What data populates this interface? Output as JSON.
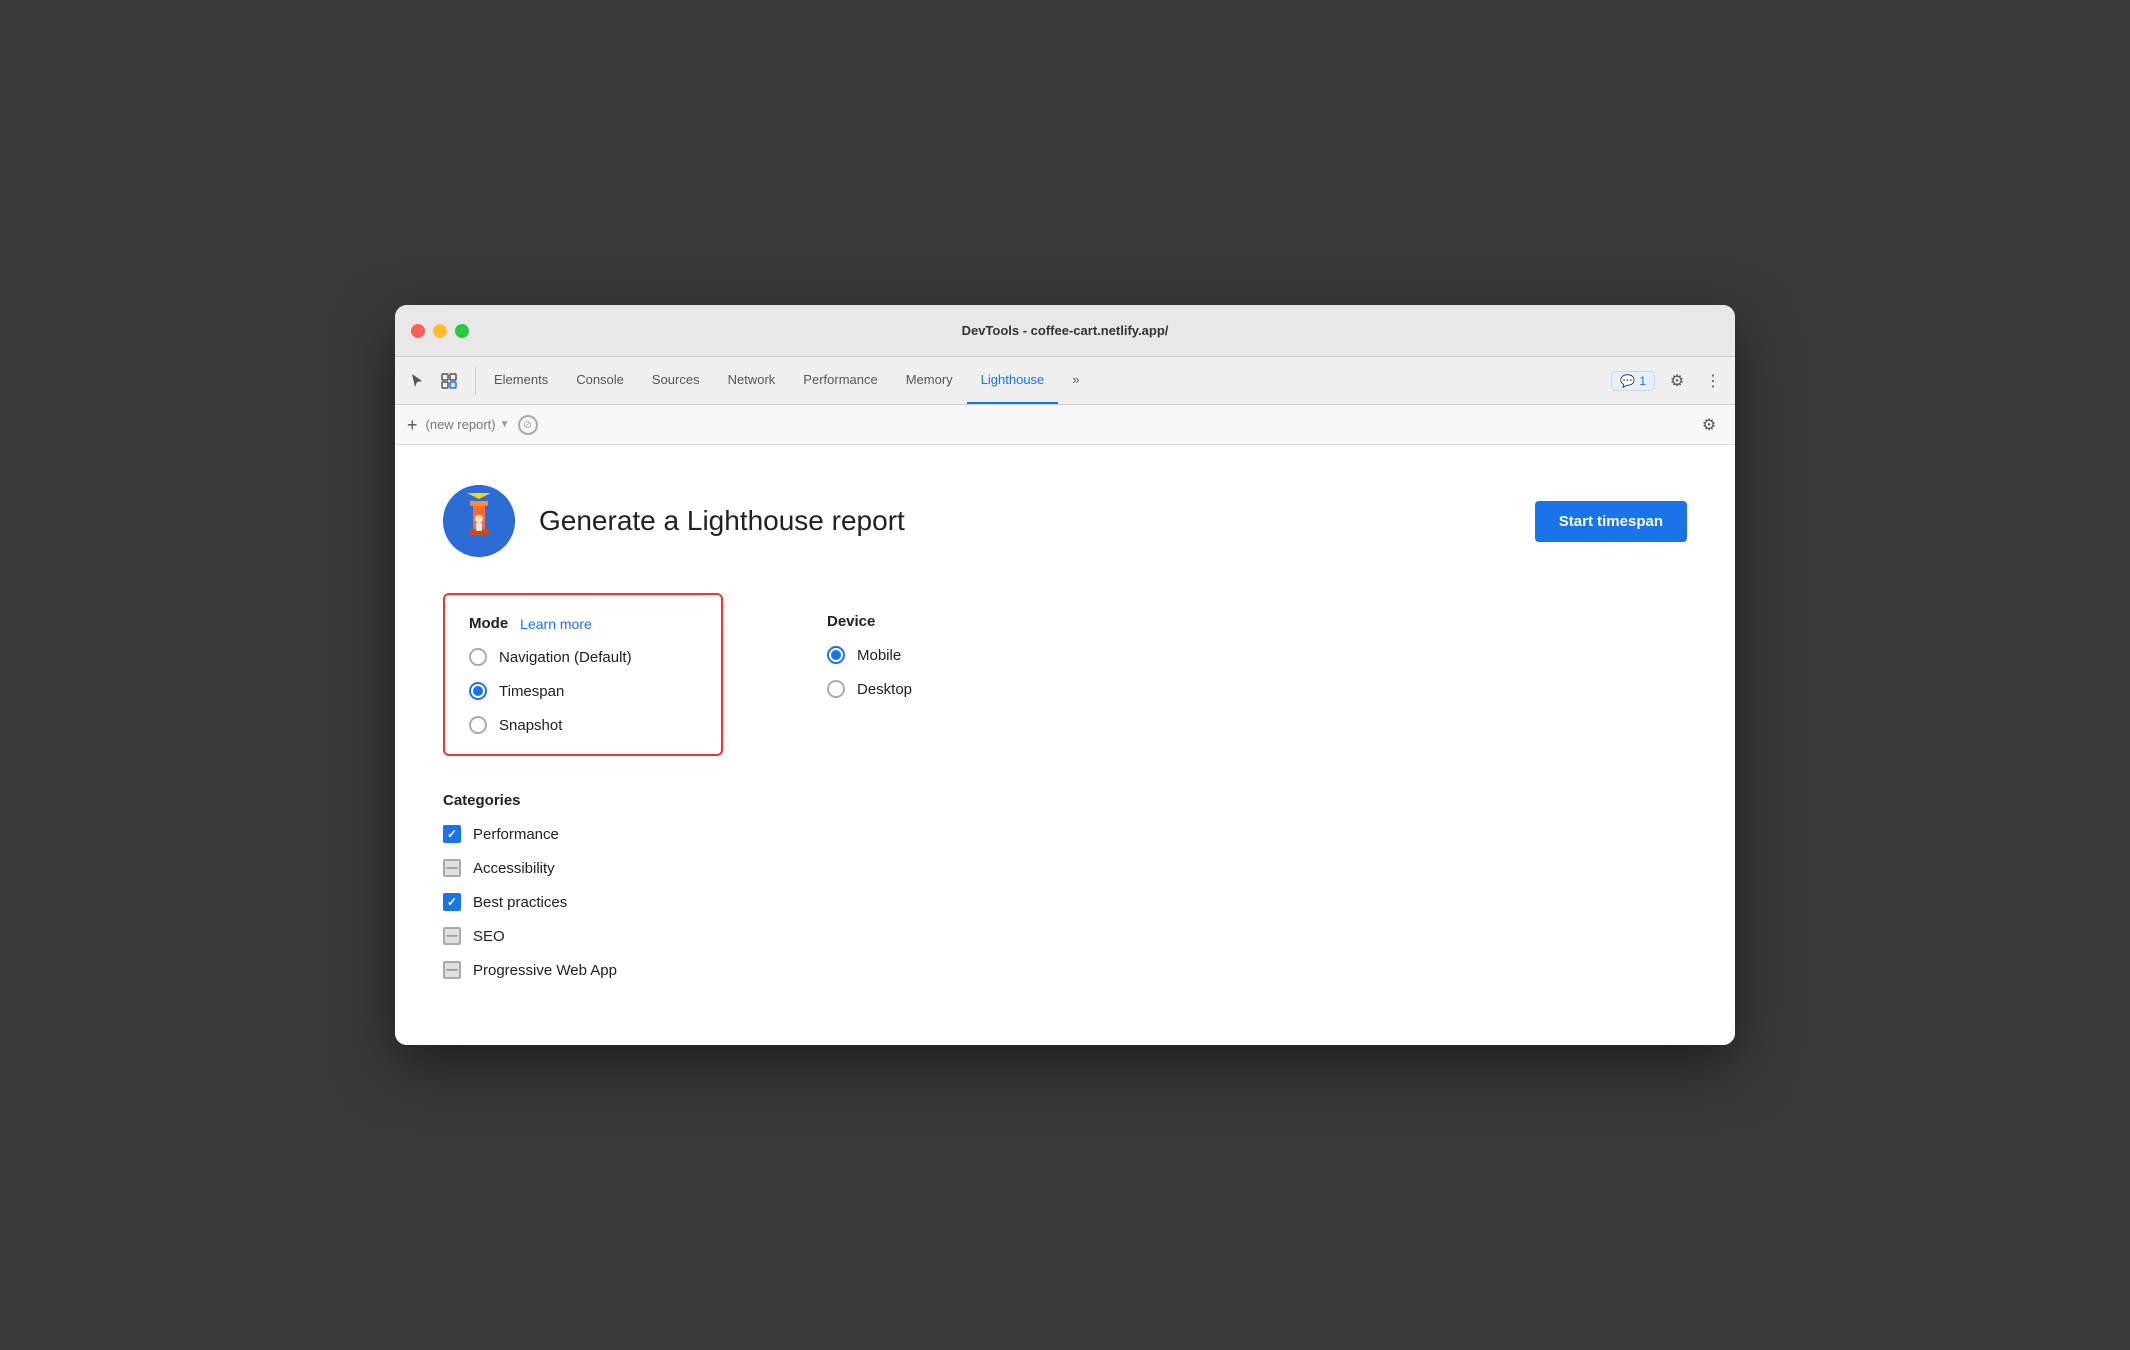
{
  "window": {
    "title": "DevTools - coffee-cart.netlify.app/"
  },
  "tabs": {
    "items": [
      {
        "id": "elements",
        "label": "Elements",
        "active": false
      },
      {
        "id": "console",
        "label": "Console",
        "active": false
      },
      {
        "id": "sources",
        "label": "Sources",
        "active": false
      },
      {
        "id": "network",
        "label": "Network",
        "active": false
      },
      {
        "id": "performance",
        "label": "Performance",
        "active": false
      },
      {
        "id": "memory",
        "label": "Memory",
        "active": false
      },
      {
        "id": "lighthouse",
        "label": "Lighthouse",
        "active": true
      }
    ],
    "more_label": "»"
  },
  "toolbar": {
    "badge_count": "1",
    "new_report_placeholder": "(new report)"
  },
  "main": {
    "header": {
      "title": "Generate a Lighthouse report",
      "start_button": "Start timespan"
    },
    "mode": {
      "title": "Mode",
      "learn_more": "Learn more",
      "options": [
        {
          "id": "navigation",
          "label": "Navigation (Default)",
          "selected": false
        },
        {
          "id": "timespan",
          "label": "Timespan",
          "selected": true
        },
        {
          "id": "snapshot",
          "label": "Snapshot",
          "selected": false
        }
      ]
    },
    "device": {
      "title": "Device",
      "options": [
        {
          "id": "mobile",
          "label": "Mobile",
          "selected": true
        },
        {
          "id": "desktop",
          "label": "Desktop",
          "selected": false
        }
      ]
    },
    "categories": {
      "title": "Categories",
      "items": [
        {
          "id": "performance",
          "label": "Performance",
          "state": "checked"
        },
        {
          "id": "accessibility",
          "label": "Accessibility",
          "state": "indeterminate"
        },
        {
          "id": "best-practices",
          "label": "Best practices",
          "state": "checked"
        },
        {
          "id": "seo",
          "label": "SEO",
          "state": "indeterminate"
        },
        {
          "id": "pwa",
          "label": "Progressive Web App",
          "state": "indeterminate"
        }
      ]
    }
  }
}
